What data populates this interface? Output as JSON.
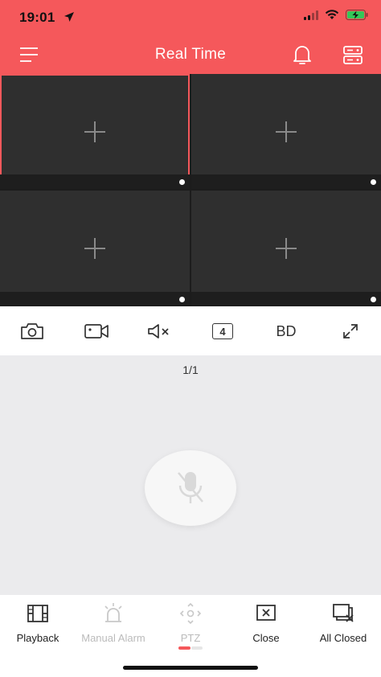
{
  "status_bar": {
    "time": "19:01"
  },
  "nav": {
    "title": "Real Time"
  },
  "grid": {
    "cells": [
      {
        "id": "cell-1",
        "active": true
      },
      {
        "id": "cell-2",
        "active": false
      },
      {
        "id": "cell-3",
        "active": false
      },
      {
        "id": "cell-4",
        "active": false
      }
    ]
  },
  "toolbar": {
    "snapshot": "camera-icon",
    "record": "video-record-icon",
    "mute": "speaker-mute-icon",
    "split_label": "4",
    "quality_label": "BD",
    "fullscreen": "expand-icon"
  },
  "talk": {
    "page_indicator": "1/1"
  },
  "bottom_tabs": [
    {
      "label": "Playback",
      "icon": "film-icon",
      "enabled": true
    },
    {
      "label": "Manual Alarm",
      "icon": "alarm-light-icon",
      "enabled": false
    },
    {
      "label": "PTZ",
      "icon": "ptz-icon",
      "enabled": false
    },
    {
      "label": "Close",
      "icon": "close-box-icon",
      "enabled": true
    },
    {
      "label": "All Closed",
      "icon": "close-all-icon",
      "enabled": true
    }
  ],
  "colors": {
    "accent": "#f5585b",
    "video_bg": "#2f2f2f",
    "panel_bg": "#ebebed"
  }
}
